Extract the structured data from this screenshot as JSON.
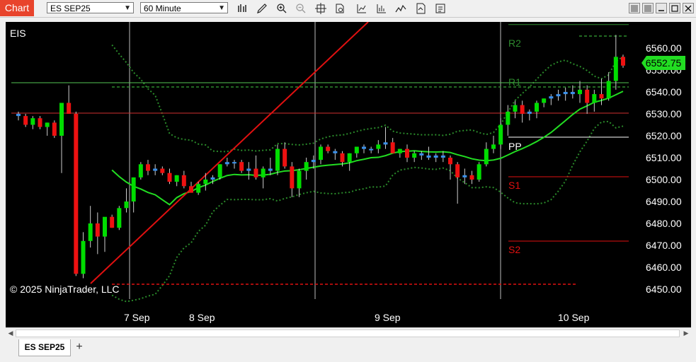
{
  "toolbar": {
    "chart_button": "Chart",
    "instrument": "ES SEP25",
    "interval": "60 Minute",
    "icons": [
      "bars-icon",
      "draw-pencil-icon",
      "zoom-in-icon",
      "zoom-out-icon",
      "crosshair-icon",
      "data-box-icon",
      "indicators-icon",
      "strategies-icon",
      "drawing-tools-icon",
      "properties-icon",
      "attach-order-icon"
    ]
  },
  "window": {
    "controls": [
      "restore-icon",
      "minimize-icon",
      "maximize-icon",
      "close-icon"
    ]
  },
  "chart": {
    "instrument_label": "EIS",
    "copyright": "© 2025 NinjaTrader, LLC",
    "last_price": "6552.75",
    "dates": [
      "7 Sep",
      "8 Sep",
      "9 Sep",
      "10 Sep"
    ],
    "price_ticks": [
      "6560.00",
      "6550.00",
      "6540.00",
      "6530.00",
      "6520.00",
      "6510.00",
      "6500.00",
      "6490.00",
      "6480.00",
      "6470.00",
      "6460.00",
      "6450.00"
    ],
    "pivot_labels": {
      "r2": "R2",
      "r1": "R1",
      "pp": "PP",
      "s1": "S1",
      "s2": "S2"
    },
    "colors": {
      "up_candle": "#00dd00",
      "down_candle": "#ee1111",
      "doji_candle": "#3b8fe8",
      "ma": "#22dd22",
      "bands": "#2a8a2a",
      "trendline": "#e01010",
      "price_badge": "#22dd22"
    }
  },
  "chart_data": {
    "type": "candlestick",
    "instrument": "ES SEP25",
    "interval": "60 Minute",
    "x_labels": [
      "7 Sep",
      "8 Sep",
      "9 Sep",
      "10 Sep"
    ],
    "ylim": [
      6447,
      6570
    ],
    "last_price": 6552.75,
    "pivots": {
      "R2": 6572,
      "R1": 6543,
      "PP": 6519,
      "S1": 6501,
      "S2": 6472
    },
    "candles": [
      [
        6530,
        6531,
        6527,
        6529
      ],
      [
        6529,
        6530,
        6524,
        6525
      ],
      [
        6525,
        6529,
        6523,
        6528
      ],
      [
        6528,
        6529,
        6523,
        6524
      ],
      [
        6524,
        6526,
        6520,
        6526
      ],
      [
        6526,
        6527,
        6519,
        6520
      ],
      [
        6520,
        6532,
        6503,
        6535
      ],
      [
        6535,
        6543,
        6532,
        6530
      ],
      [
        6530,
        6531,
        6456,
        6457
      ],
      [
        6457,
        6476,
        6455,
        6472
      ],
      [
        6472,
        6488,
        6469,
        6480
      ],
      [
        6480,
        6485,
        6466,
        6474
      ],
      [
        6474,
        6478,
        6467,
        6483
      ],
      [
        6483,
        6484,
        6478,
        6478
      ],
      [
        6478,
        6488,
        6477,
        6487
      ],
      [
        6487,
        6496,
        6485,
        6490
      ],
      [
        6490,
        6501,
        6485,
        6501
      ],
      [
        6501,
        6508,
        6500,
        6507
      ],
      [
        6507,
        6509,
        6502,
        6504
      ],
      [
        6504,
        6507,
        6502,
        6505
      ],
      [
        6505,
        6506,
        6502,
        6503
      ],
      [
        6503,
        6505,
        6498,
        6499
      ],
      [
        6499,
        6502,
        6497,
        6502
      ],
      [
        6502,
        6504,
        6496,
        6497
      ],
      [
        6497,
        6499,
        6494,
        6494
      ],
      [
        6494,
        6499,
        6493,
        6498
      ],
      [
        6498,
        6503,
        6495,
        6500
      ],
      [
        6500,
        6502,
        6498,
        6501
      ],
      [
        6501,
        6507,
        6500,
        6507
      ],
      [
        6507,
        6510,
        6506,
        6508
      ],
      [
        6508,
        6509,
        6505,
        6508
      ],
      [
        6508,
        6509,
        6503,
        6504
      ],
      [
        6504,
        6508,
        6500,
        6505
      ],
      [
        6505,
        6511,
        6500,
        6501
      ],
      [
        6501,
        6506,
        6496,
        6505
      ],
      [
        6505,
        6510,
        6502,
        6504
      ],
      [
        6504,
        6516,
        6502,
        6514
      ],
      [
        6514,
        6517,
        6505,
        6506
      ],
      [
        6506,
        6508,
        6492,
        6496
      ],
      [
        6496,
        6505,
        6492,
        6504
      ],
      [
        6504,
        6510,
        6500,
        6508
      ],
      [
        6508,
        6511,
        6505,
        6509
      ],
      [
        6509,
        6516,
        6507,
        6515
      ],
      [
        6515,
        6516,
        6512,
        6513
      ],
      [
        6513,
        6514,
        6509,
        6512
      ],
      [
        6512,
        6513,
        6506,
        6508
      ],
      [
        6508,
        6512,
        6504,
        6512
      ],
      [
        6512,
        6515,
        6510,
        6515
      ],
      [
        6515,
        6516,
        6512,
        6514
      ],
      [
        6514,
        6515,
        6512,
        6514
      ],
      [
        6514,
        6518,
        6512,
        6516
      ],
      [
        6516,
        6524,
        6514,
        6517
      ],
      [
        6517,
        6519,
        6512,
        6512
      ],
      [
        6512,
        6514,
        6510,
        6514
      ],
      [
        6514,
        6516,
        6508,
        6510
      ],
      [
        6510,
        6513,
        6508,
        6512
      ],
      [
        6512,
        6513,
        6509,
        6511
      ],
      [
        6511,
        6515,
        6509,
        6510
      ],
      [
        6510,
        6512,
        6508,
        6511
      ],
      [
        6511,
        6513,
        6508,
        6510
      ],
      [
        6510,
        6511,
        6500,
        6507
      ],
      [
        6507,
        6508,
        6489,
        6501
      ],
      [
        6501,
        6505,
        6498,
        6502
      ],
      [
        6502,
        6504,
        6498,
        6500
      ],
      [
        6500,
        6508,
        6499,
        6507
      ],
      [
        6507,
        6517,
        6506,
        6514
      ],
      [
        6514,
        6520,
        6512,
        6516
      ],
      [
        6516,
        6528,
        6514,
        6525
      ],
      [
        6525,
        6534,
        6520,
        6531
      ],
      [
        6531,
        6536,
        6528,
        6534
      ],
      [
        6534,
        6536,
        6526,
        6530
      ],
      [
        6530,
        6532,
        6527,
        6531
      ],
      [
        6531,
        6536,
        6528,
        6535
      ],
      [
        6535,
        6537,
        6533,
        6537
      ],
      [
        6537,
        6539,
        6534,
        6538
      ],
      [
        6538,
        6541,
        6536,
        6539
      ],
      [
        6539,
        6542,
        6536,
        6540
      ],
      [
        6540,
        6543,
        6537,
        6539
      ],
      [
        6539,
        6545,
        6535,
        6541
      ],
      [
        6541,
        6543,
        6530,
        6535
      ],
      [
        6535,
        6541,
        6531,
        6539
      ],
      [
        6539,
        6546,
        6534,
        6537
      ],
      [
        6537,
        6549,
        6536,
        6545
      ],
      [
        6545,
        6566,
        6541,
        6556
      ],
      [
        6556,
        6557,
        6551,
        6552
      ]
    ]
  }
}
